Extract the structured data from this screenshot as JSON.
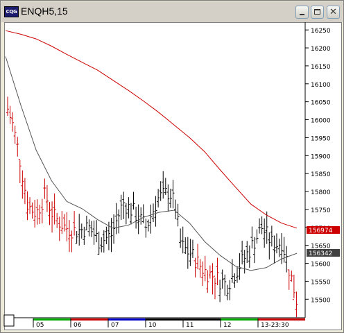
{
  "window": {
    "title": "ENQH5,15",
    "app_icon_label": "CQG"
  },
  "chart_data": {
    "type": "ohlc",
    "symbol": "ENQH5",
    "interval": "15",
    "ylim": [
      15460,
      16260
    ],
    "y_ticks": [
      "16250",
      "16200",
      "16150",
      "16100",
      "16050",
      "16000",
      "15950",
      "15900",
      "15850",
      "15800",
      "15750",
      "15700",
      "15650",
      "15600",
      "15550",
      "15500"
    ],
    "last_price_red": "156974",
    "last_price_gray": "156342",
    "x_labels": [
      "05",
      "06",
      "07",
      "10",
      "11",
      "12",
      "13-23:30"
    ],
    "colors": {
      "up_bar": "#000000",
      "down_bar": "#cc0000",
      "ma_long": "#cc0000",
      "ma_short": "#555555"
    },
    "moving_average_red": [
      16248,
      16238,
      16225,
      16205,
      16182,
      16160,
      16138,
      16110,
      16082,
      16052,
      16020,
      15985,
      15950,
      15910,
      15860,
      15812,
      15765,
      15735,
      15712,
      15698
    ],
    "moving_average_gray": [
      16176,
      16040,
      15915,
      15830,
      15772,
      15752,
      15722,
      15698,
      15706,
      15728,
      15742,
      15748,
      15712,
      15660,
      15622,
      15592,
      15580,
      15588,
      15612,
      15628
    ]
  }
}
